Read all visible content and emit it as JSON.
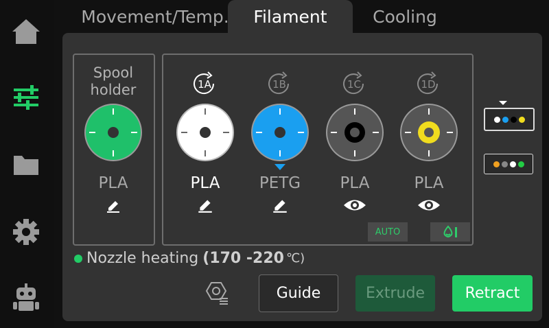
{
  "tabs": [
    {
      "label": "Movement/Temp."
    },
    {
      "label": "Filament"
    },
    {
      "label": "Cooling"
    }
  ],
  "spool_holder": {
    "title_line1": "Spool",
    "title_line2": "holder",
    "color": "#1fc06a",
    "material": "PLA"
  },
  "slots": [
    {
      "label": "1A",
      "color": "#ffffff",
      "material": "PLA",
      "action": "edit",
      "active": true
    },
    {
      "label": "1B",
      "color": "#1a9ff0",
      "material": "PETG",
      "action": "edit",
      "active": false,
      "selected": true
    },
    {
      "label": "1C",
      "color": "#000000",
      "material": "PLA",
      "action": "view",
      "active": false
    },
    {
      "label": "1D",
      "color": "#f0dc1e",
      "material": "PLA",
      "action": "view",
      "active": false
    }
  ],
  "badges": {
    "auto": "AUTO"
  },
  "nozzle": {
    "text": "Nozzle heating",
    "range": "(170 -220",
    "unit": "℃)"
  },
  "buttons": {
    "guide": "Guide",
    "extrude": "Extrude",
    "retract": "Retract"
  },
  "colors": {
    "accent": "#22cc66",
    "panel": "#333333"
  },
  "strips": [
    {
      "dots": [
        "#ffffff",
        "#1a9ff0",
        "#000000",
        "#f0dc1e"
      ],
      "selected": true
    },
    {
      "dots": [
        "#f0a020",
        "#888888",
        "#ffffff",
        "#22cc44"
      ],
      "selected": false
    }
  ]
}
